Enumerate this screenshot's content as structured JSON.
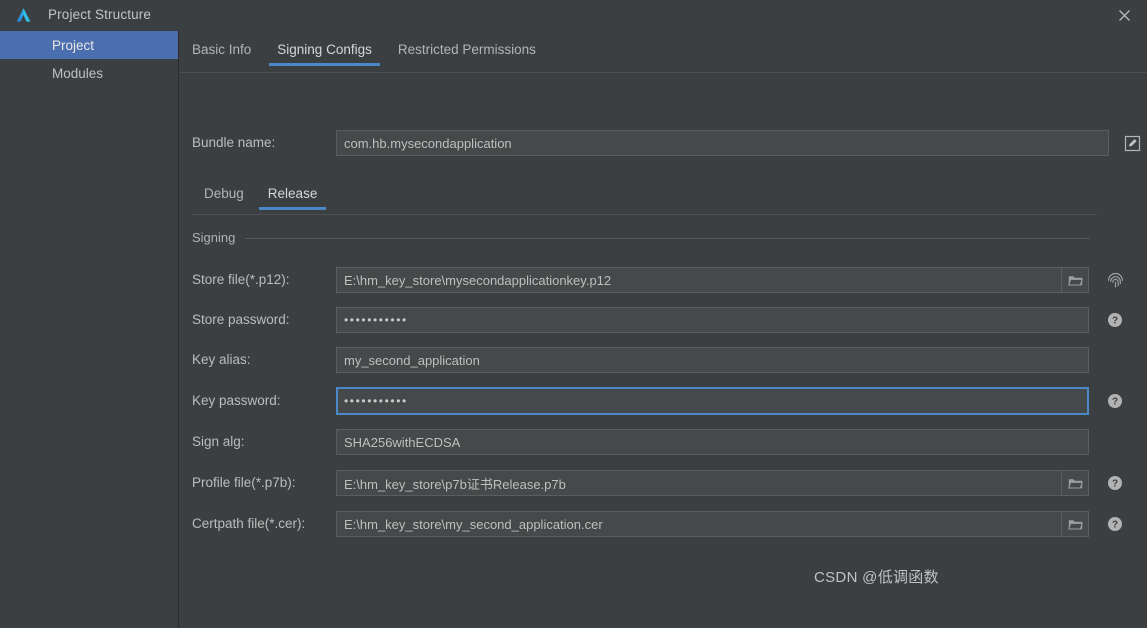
{
  "window": {
    "title": "Project Structure",
    "logo_icon": "deveco-logo-icon",
    "close_icon": "close-icon"
  },
  "sidebar": {
    "items": [
      {
        "label": "Project",
        "selected": true
      },
      {
        "label": "Modules",
        "selected": false
      }
    ]
  },
  "tabs": [
    {
      "label": "Basic Info",
      "active": false
    },
    {
      "label": "Signing Configs",
      "active": true
    },
    {
      "label": "Restricted Permissions",
      "active": false
    }
  ],
  "bundle": {
    "label": "Bundle name:",
    "value": "com.hb.mysecondapplication",
    "edit_icon": "edit-icon"
  },
  "subtabs": [
    {
      "label": "Debug",
      "active": false
    },
    {
      "label": "Release",
      "active": true
    }
  ],
  "group": {
    "title": "Signing"
  },
  "fields": [
    {
      "label": "Store file(*.p12):",
      "value": "E:\\hm_key_store\\mysecondapplicationkey.p12",
      "type": "text",
      "browse": true,
      "trailing_icon": "fingerprint-icon"
    },
    {
      "label": "Store password:",
      "value": "•••••••••••",
      "type": "password",
      "browse": false,
      "trailing_icon": "help-icon"
    },
    {
      "label": "Key alias:",
      "value": "my_second_application",
      "type": "text",
      "browse": false,
      "trailing_icon": ""
    },
    {
      "label": "Key password:",
      "value": "•••••••••••",
      "type": "password",
      "browse": false,
      "trailing_icon": "help-icon",
      "focused": true
    },
    {
      "label": "Sign alg:",
      "value": "SHA256withECDSA",
      "type": "text",
      "browse": false,
      "trailing_icon": ""
    },
    {
      "label": "Profile file(*.p7b):",
      "value": "E:\\hm_key_store\\p7b证书Release.p7b",
      "type": "text",
      "browse": true,
      "trailing_icon": "help-icon"
    },
    {
      "label": "Certpath file(*.cer):",
      "value": "E:\\hm_key_store\\my_second_application.cer",
      "type": "text",
      "browse": true,
      "trailing_icon": "help-icon"
    }
  ],
  "watermark": {
    "text": "CSDN @低调函数"
  },
  "colors": {
    "window_bg": "#3c3f41",
    "field_bg": "#45494a",
    "accent": "#4a88c7",
    "selection": "#4b6eaf",
    "text": "#bcbcbc"
  }
}
